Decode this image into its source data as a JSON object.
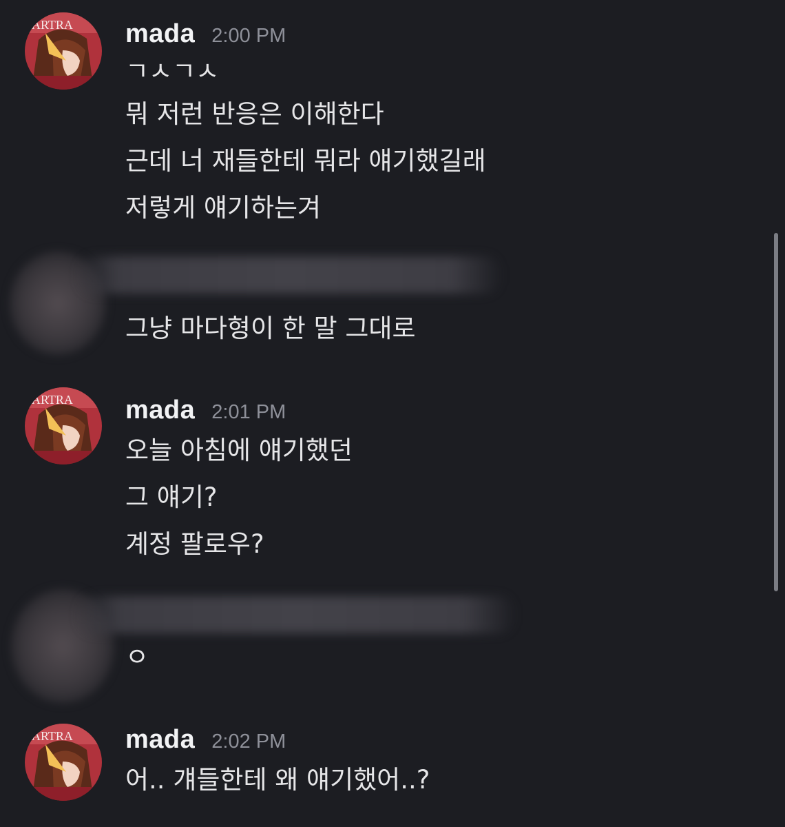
{
  "messages": [
    {
      "username": "mada",
      "time": "2:00 PM",
      "lines": [
        "ㄱㅅㄱㅅ",
        "뭐 저런 반응은 이해한다",
        "근데 너 재들한테 뭐라 얘기했길래",
        "저렇게 얘기하는겨"
      ]
    },
    {
      "lines": [
        "그냥 마다형이 한 말 그대로"
      ]
    },
    {
      "username": "mada",
      "time": "2:01 PM",
      "lines": [
        "오늘 아침에 얘기했던",
        "그 얘기?",
        "계정 팔로우?"
      ]
    },
    {
      "lines": [
        "ㅇ"
      ]
    },
    {
      "username": "mada",
      "time": "2:02 PM",
      "lines": [
        "어.. 걔들한테 왜 얘기했어..?"
      ]
    }
  ],
  "colors": {
    "background": "#1c1d22",
    "username": "#f2f3f5",
    "timestamp": "#8e9099",
    "text": "#e6e6e8"
  },
  "icons": {
    "avatar": "anime-avatar-icon"
  }
}
